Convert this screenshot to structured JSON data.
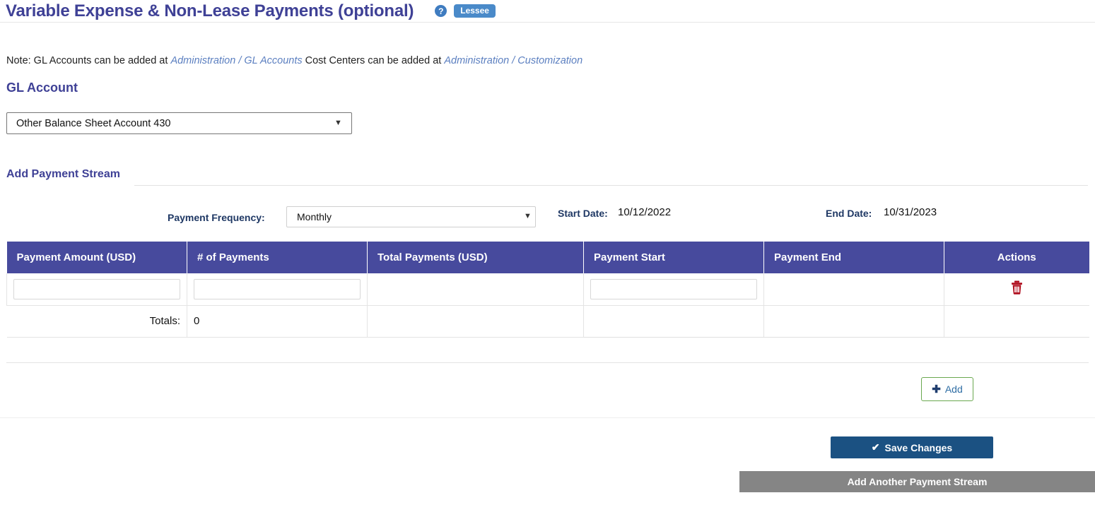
{
  "header": {
    "title": "Variable Expense & Non-Lease Payments (optional)",
    "help_icon": "question-mark-icon",
    "role_badge": "Lessee",
    "title_color": "#3f4196"
  },
  "note": {
    "prefix": "Note: GL Accounts can be added at ",
    "link1": "Administration / GL Accounts",
    "middle": " Cost Centers can be added at ",
    "link2": "Administration / Customization",
    "link_color": "#5b7fc0"
  },
  "gl_account": {
    "heading": "GL Account",
    "selected": "Other Balance Sheet Account 430",
    "caret": "chevron-down-icon"
  },
  "add_payment_stream": {
    "heading": "Add Payment Stream",
    "frequency_label": "Payment Frequency:",
    "frequency_value": "Monthly",
    "frequency_caret": "chevron-down-icon",
    "start_date_label": "Start Date:",
    "start_date_value": "10/12/2022",
    "end_date_label": "End Date:",
    "end_date_value": "10/31/2023"
  },
  "table": {
    "header_bg": "#474a9d",
    "columns": [
      "Payment Amount (USD)",
      "# of Payments",
      "Total Payments (USD)",
      "Payment Start",
      "Payment End",
      "Actions"
    ],
    "rows": [
      {
        "payment_amount": "",
        "num_payments": "",
        "total_payments": "",
        "payment_start": "",
        "payment_end": "",
        "action_icon": "trash-icon"
      }
    ],
    "totals_label": "Totals:",
    "totals_value": "0"
  },
  "actions": {
    "add_label": "Add",
    "add_plus_icon": "plus-icon",
    "add_border_color": "#6aa84f",
    "save_label": "Save Changes",
    "save_check_icon": "check-icon",
    "save_bg": "#1b5182",
    "another_stream_label": "Add Another Payment Stream",
    "another_bg": "#858585"
  }
}
